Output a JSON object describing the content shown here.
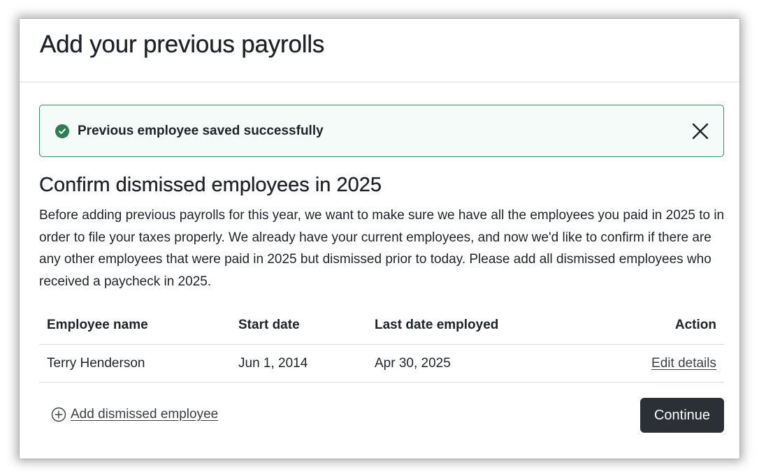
{
  "modal": {
    "title": "Add your previous payrolls"
  },
  "alert": {
    "message": "Previous employee saved successfully",
    "icon": "check-circle-icon",
    "close_icon": "close-icon",
    "border_color": "#3f8a66",
    "icon_color": "#2f7d54",
    "background": "#f4fbf9"
  },
  "section": {
    "title": "Confirm dismissed employees in 2025",
    "description": "Before adding previous payrolls for this year, we want to make sure we have all the employees you paid in 2025 to in order to file your taxes properly. We already have your current employees, and now we'd like to confirm if there are any other employees that were paid in 2025 but dismissed prior to today. Please add all dismissed employees who received a paycheck in 2025."
  },
  "table": {
    "headers": {
      "name": "Employee name",
      "start": "Start date",
      "last": "Last date employed",
      "action": "Action"
    },
    "rows": [
      {
        "name": "Terry Henderson",
        "start": "Jun 1, 2014",
        "last": "Apr 30, 2025",
        "action": "Edit details"
      }
    ]
  },
  "footer": {
    "add_label": "Add dismissed employee",
    "add_icon": "plus-circle-icon",
    "continue_label": "Continue",
    "button_color": "#2c3035"
  }
}
